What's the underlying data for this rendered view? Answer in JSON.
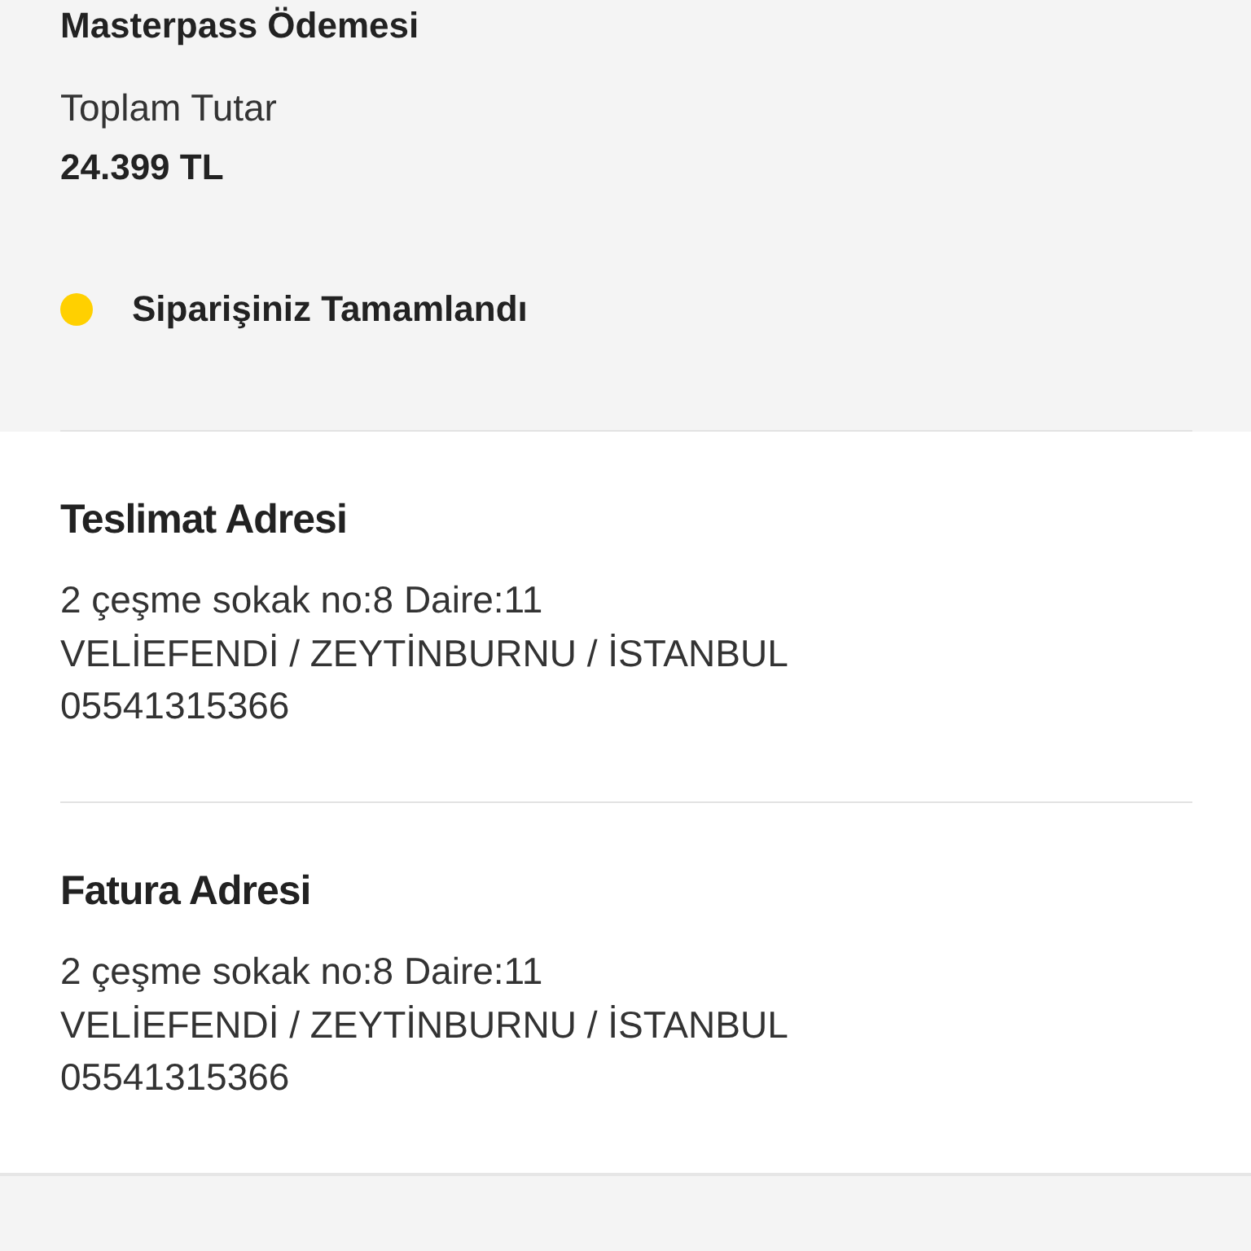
{
  "payment": {
    "method": "Masterpass Ödemesi",
    "total_label": "Toplam Tutar",
    "total": "24.399 TL"
  },
  "order_status": {
    "label": "Siparişiniz Tamamlandı",
    "color": "#ffd000"
  },
  "addresses": [
    {
      "title": "Teslimat Adresi",
      "lines": [
        "2 çeşme sokak no:8 Daire:11",
        "VELİEFENDİ / ZEYTİNBURNU / İSTANBUL",
        "05541315366"
      ]
    },
    {
      "title": "Fatura Adresi",
      "lines": [
        "2 çeşme sokak no:8 Daire:11",
        "VELİEFENDİ / ZEYTİNBURNU / İSTANBUL",
        "05541315366"
      ]
    }
  ]
}
